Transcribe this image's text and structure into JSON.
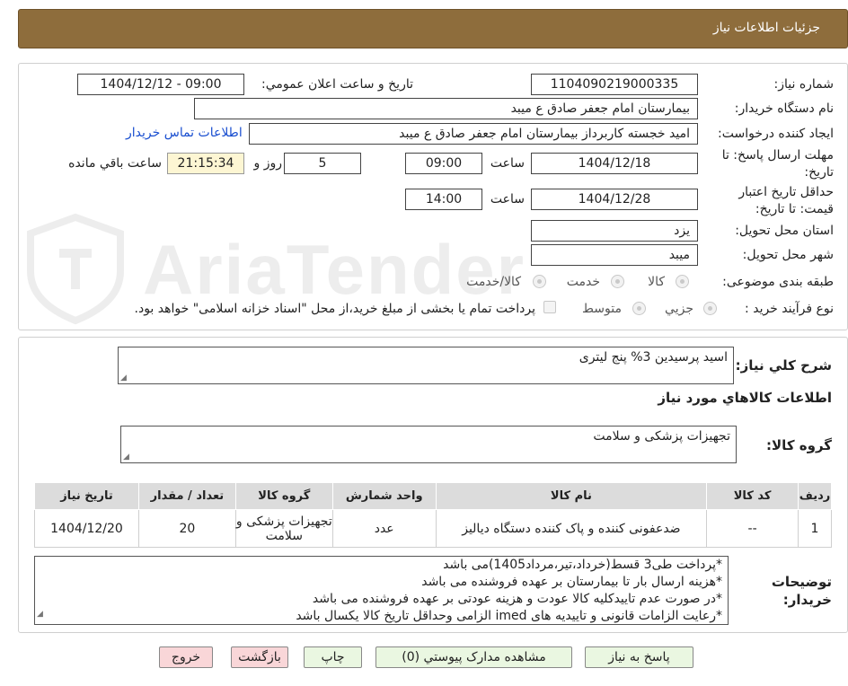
{
  "header": {
    "title": "جزئیات اطلاعات نیاز"
  },
  "fields": {
    "need_number_label": "شماره نیاز:",
    "need_number": "1104090219000335",
    "announce_label": "تاریخ و ساعت اعلان عمومي:",
    "announce_value": "1404/12/12 - 09:00",
    "buyer_org_label": "نام دستگاه خریدار:",
    "buyer_org": "بیمارستان امام جعفر صادق  ع  میبد",
    "requester_label": "ایجاد کننده درخواست:",
    "requester": "امید خجسته کاربرداز بیمارستان امام جعفر صادق  ع  میبد",
    "contact_link": "اطلاعات تماس خریدار",
    "deadline_label": "مهلت ارسال پاسخ: تا تاریخ:",
    "deadline_date": "1404/12/18",
    "time_label": "ساعت",
    "deadline_time": "09:00",
    "days": "5",
    "days_label": "روز و",
    "remaining_time": "21:15:34",
    "remaining_label": "ساعت باقي مانده",
    "validity_label": "حداقل تاریخ اعتبار قیمت: تا تاریخ:",
    "validity_date": "1404/12/28",
    "validity_time": "14:00",
    "province_label": "استان محل تحویل:",
    "province": "یزد",
    "city_label": "شهر محل تحویل:",
    "city": "میبد",
    "category_label": "طبقه بندی موضوعی:",
    "category_options": [
      "کالا",
      "خدمت",
      "کالا/خدمت"
    ],
    "process_label": "نوع فرآیند خرید :",
    "process_options": [
      "جزیي",
      "متوسط"
    ],
    "payment_note": "پرداخت تمام یا بخشی از مبلغ خرید،از محل \"اسناد خزانه اسلامی\" خواهد بود."
  },
  "summary": {
    "label": "شرح کلي نیاز:",
    "value": "اسید پرسیدین 3% پنج لیتری",
    "goods_info_title": "اطلاعات کالاهاي مورد نیاز",
    "group_label": "گروه کالا:",
    "group_value": "تجهیزات پزشکی و سلامت"
  },
  "table": {
    "headers": [
      "ردیف",
      "کد کالا",
      "نام کالا",
      "واحد شمارش",
      "گروه کالا",
      "تعداد / مقدار",
      "تاریخ نیاز"
    ],
    "rows": [
      [
        "1",
        "--",
        "ضدعفونی کننده و پاک کننده دستگاه دیالیز",
        "عدد",
        "تجهیزات پزشکی و سلامت",
        "20",
        "1404/12/20"
      ]
    ]
  },
  "notes": {
    "label": "توضیحات خریدار:",
    "lines": [
      "*پرداخت طی3 قسط(خرداد،تیر،مرداد1405)می باشد",
      "*هزینه ارسال بار تا بیمارستان بر عهده فروشنده می باشد",
      "*در صورت عدم تاییدکلیه کالا عودت و هزینه عودتی بر عهده فروشنده می باشد",
      "*رعایت الزامات قانونی و تاییدیه های imed  الزامی وحداقل تاریخ کالا یکسال باشد"
    ]
  },
  "buttons": {
    "reply": "پاسخ به نیاز",
    "attachments": "مشاهده مدارک پیوستي (0)",
    "print": "چاپ",
    "back": "بازگشت",
    "exit": "خروج"
  },
  "watermark": {
    "text": "AriaTender.net"
  },
  "colors": {
    "header": "#8e6d3c",
    "link": "#1a4fd0",
    "timer_bg": "#fdf6d3",
    "green_btn": "#eaf7e1",
    "pink_btn": "#f9d6d8"
  }
}
